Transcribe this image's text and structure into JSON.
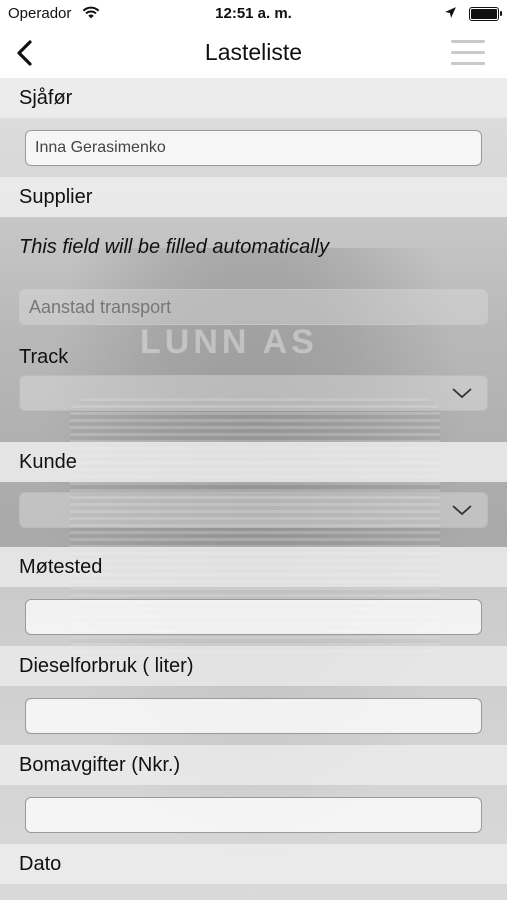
{
  "status_bar": {
    "carrier": "Operador",
    "time": "12:51 a. m."
  },
  "nav": {
    "title": "Lasteliste"
  },
  "form": {
    "driver_label": "Sjåfør",
    "driver_value": "Inna Gerasimenko",
    "supplier_label": "Supplier",
    "supplier_note": "This field will be filled automatically",
    "supplier_value": "Aanstad transport",
    "track_label": "Track",
    "track_value": "",
    "customer_label": "Kunde",
    "customer_value": "",
    "meeting_place_label": "Møtested",
    "meeting_place_value": "",
    "diesel_label": "Dieselforbruk ( liter)",
    "diesel_value": "",
    "toll_label": "Bomavgifter (Nkr.)",
    "toll_value": "",
    "date_label": "Dato"
  },
  "background": {
    "logo_text": "LUNN AS"
  }
}
